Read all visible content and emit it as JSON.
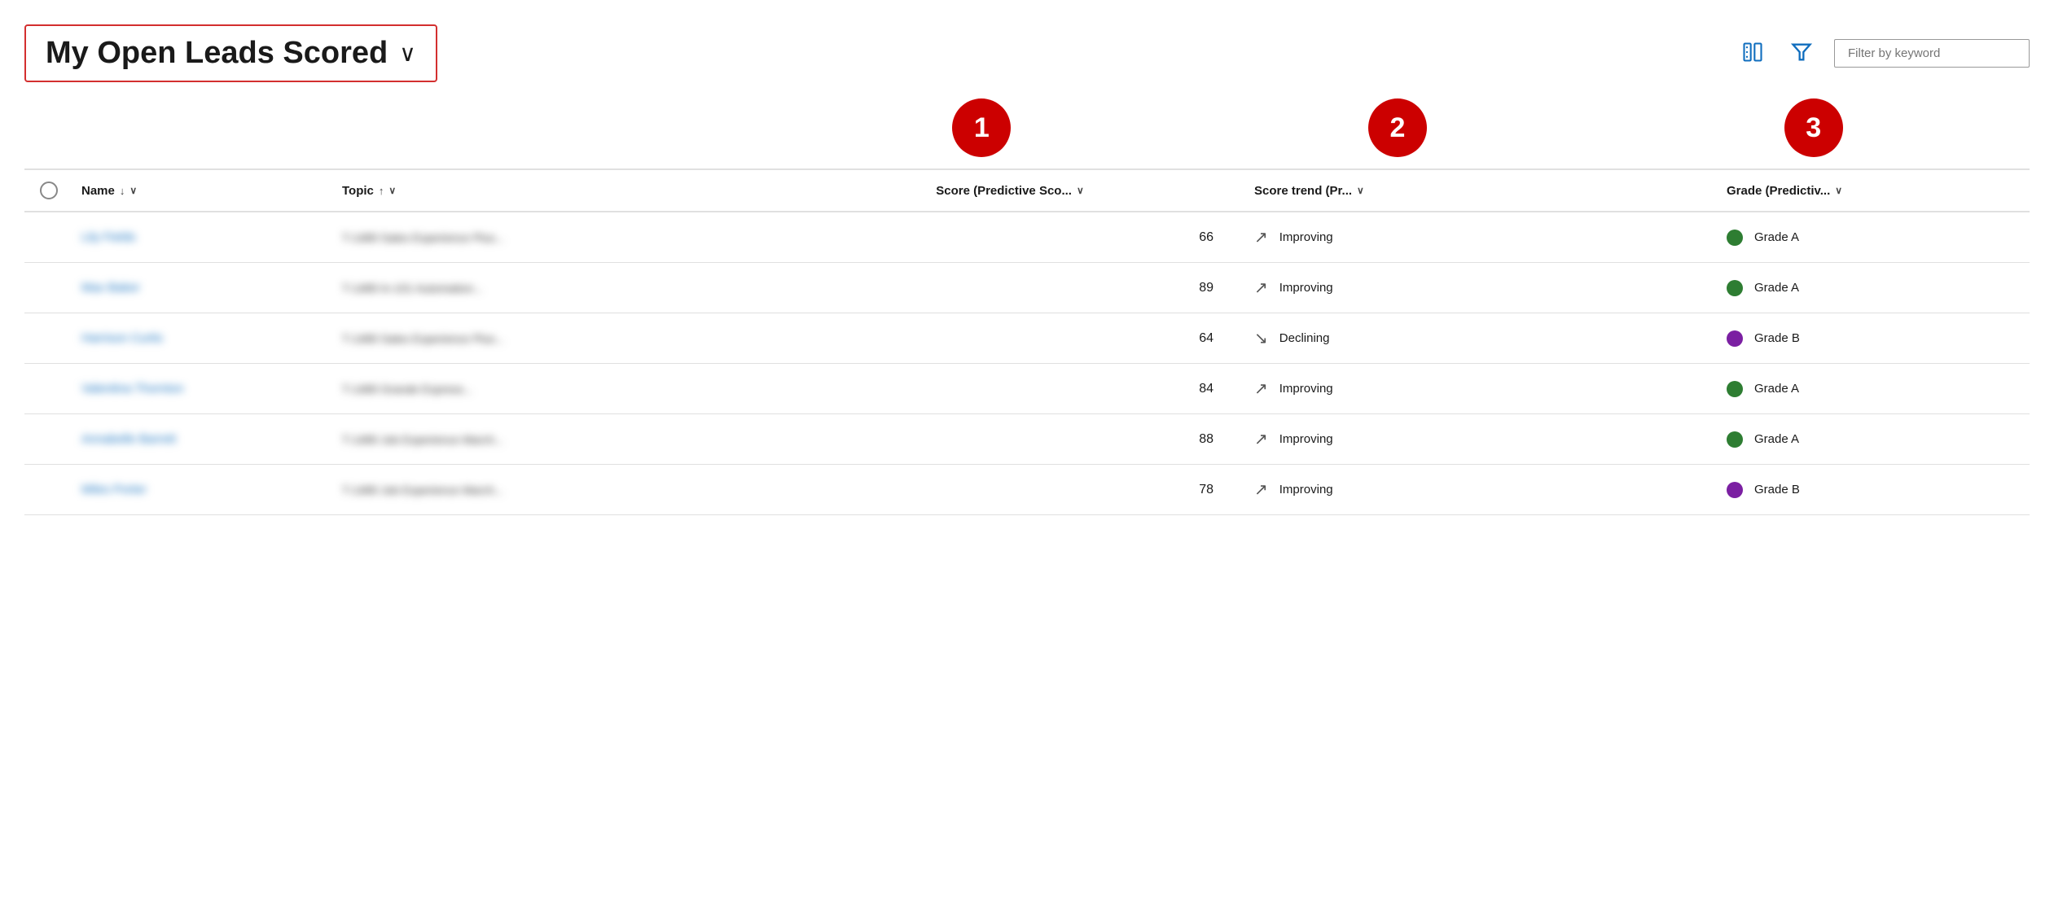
{
  "header": {
    "title": "My Open Leads Scored",
    "chevron": "∨",
    "filter_placeholder": "Filter by keyword"
  },
  "badges": [
    {
      "number": "1",
      "col": "score"
    },
    {
      "number": "2",
      "col": "trend"
    },
    {
      "number": "3",
      "col": "grade"
    }
  ],
  "columns": [
    {
      "id": "checkbox",
      "label": ""
    },
    {
      "id": "name",
      "label": "Name",
      "sort": "↓",
      "chevron": "∨"
    },
    {
      "id": "topic",
      "label": "Topic",
      "sort": "↑",
      "chevron": "∨"
    },
    {
      "id": "score",
      "label": "Score (Predictive Sco...",
      "chevron": "∨"
    },
    {
      "id": "trend",
      "label": "Score trend (Pr...",
      "chevron": "∨"
    },
    {
      "id": "grade",
      "label": "Grade (Predictiv...",
      "chevron": "∨"
    }
  ],
  "rows": [
    {
      "name": "Lily Fields",
      "topic": "T-1489 Sales Experience Plus...",
      "score": 66,
      "trend_arrow": "↗",
      "trend_label": "Improving",
      "grade_color": "green",
      "grade_label": "Grade A"
    },
    {
      "name": "Max Baker",
      "topic": "T-1489 In-101 Automation...",
      "score": 89,
      "trend_arrow": "↗",
      "trend_label": "Improving",
      "grade_color": "green",
      "grade_label": "Grade A"
    },
    {
      "name": "Harrison Curtis",
      "topic": "T-1489 Sales Experience Plus...",
      "score": 64,
      "trend_arrow": "↘",
      "trend_label": "Declining",
      "grade_color": "purple",
      "grade_label": "Grade B"
    },
    {
      "name": "Valentina Thornton",
      "topic": "T-1489 Grande Express...",
      "score": 84,
      "trend_arrow": "↗",
      "trend_label": "Improving",
      "grade_color": "green",
      "grade_label": "Grade A"
    },
    {
      "name": "Annabelle Barrett",
      "topic": "T-1489 Job Experience March...",
      "score": 88,
      "trend_arrow": "↗",
      "trend_label": "Improving",
      "grade_color": "green",
      "grade_label": "Grade A"
    },
    {
      "name": "Miles Porter",
      "topic": "T-1489 Job Experience March...",
      "score": 78,
      "trend_arrow": "↗",
      "trend_label": "Improving",
      "grade_color": "purple",
      "grade_label": "Grade B"
    }
  ],
  "icons": {
    "columns_icon": "⊞",
    "filter_icon": "⛉"
  }
}
